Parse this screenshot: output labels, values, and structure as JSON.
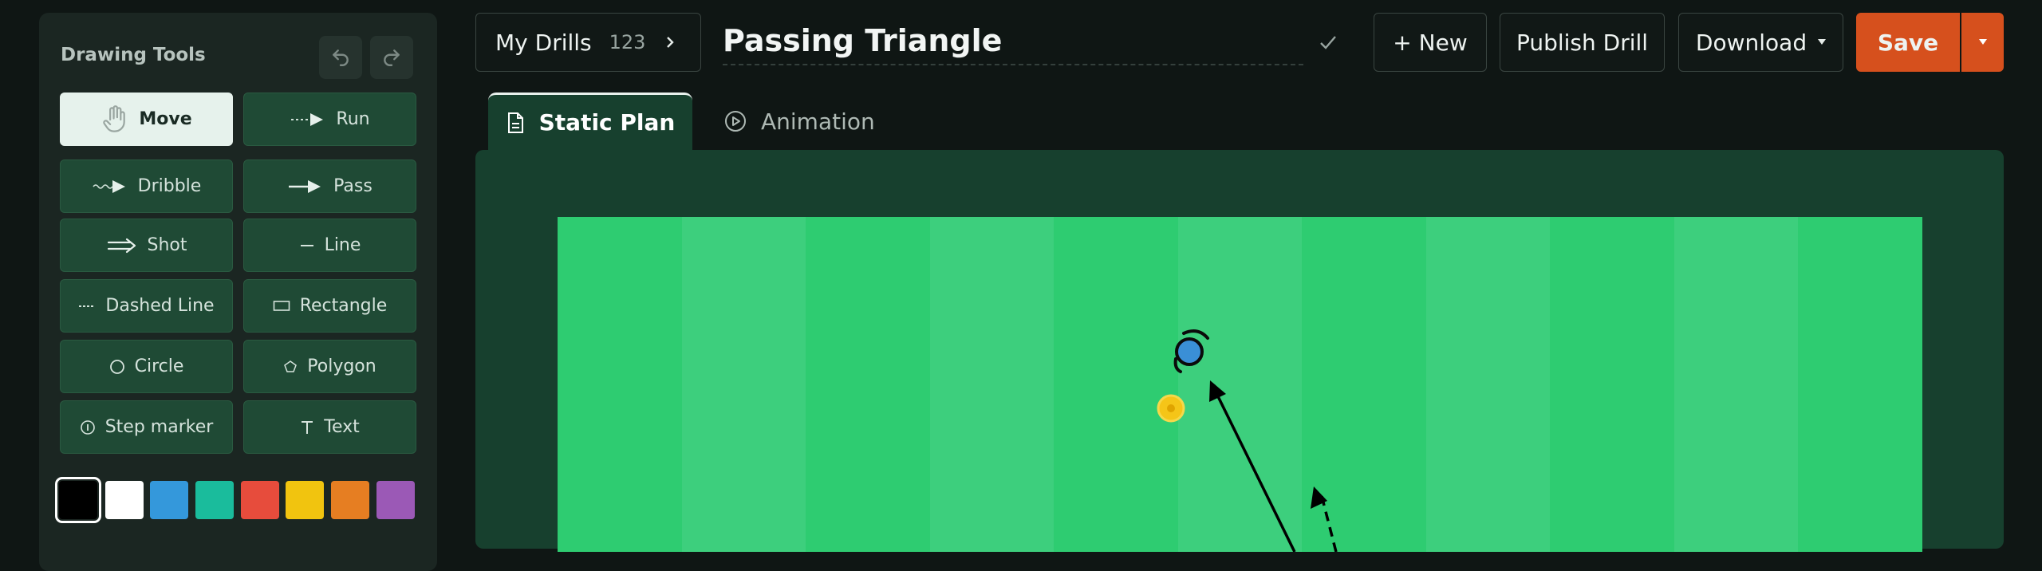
{
  "sidebar": {
    "title": "Drawing Tools",
    "undo_icon": "undo-icon",
    "redo_icon": "redo-icon",
    "tools": [
      {
        "label": "Move",
        "icon": "hand-icon",
        "active": true
      },
      {
        "label": "Run",
        "icon": "run-arrow-icon"
      },
      {
        "label": "Dribble",
        "icon": "dribble-arrow-icon"
      },
      {
        "label": "Pass",
        "icon": "pass-arrow-icon"
      },
      {
        "label": "Shot",
        "icon": "shot-arrow-icon"
      },
      {
        "label": "Line",
        "icon": "line-icon"
      },
      {
        "label": "Dashed Line",
        "icon": "dashed-line-icon"
      },
      {
        "label": "Rectangle",
        "icon": "rectangle-icon"
      },
      {
        "label": "Circle",
        "icon": "circle-icon"
      },
      {
        "label": "Polygon",
        "icon": "polygon-icon"
      },
      {
        "label": "Step marker",
        "icon": "step-marker-icon"
      },
      {
        "label": "Text",
        "icon": "text-icon"
      }
    ],
    "colors": [
      "#000000",
      "#ffffff",
      "#3498db",
      "#1abc9c",
      "#e74c3c",
      "#f1c40f",
      "#e67e22",
      "#9b59b6"
    ],
    "selected_color": "#000000"
  },
  "header": {
    "my_drills_label": "My Drills",
    "my_drills_count": "123",
    "drill_title": "Passing Triangle",
    "new_label": "+ New",
    "publish_label": "Publish Drill",
    "download_label": "Download",
    "save_label": "Save"
  },
  "tabs": [
    {
      "label": "Static Plan",
      "icon": "document-icon",
      "active": true
    },
    {
      "label": "Animation",
      "icon": "play-circle-icon",
      "active": false
    }
  ],
  "colors": {
    "accent": "#d6501d",
    "pitch_light": "#3dcf7d",
    "pitch_dark": "#2ecc71",
    "field_bg": "#17402e"
  }
}
